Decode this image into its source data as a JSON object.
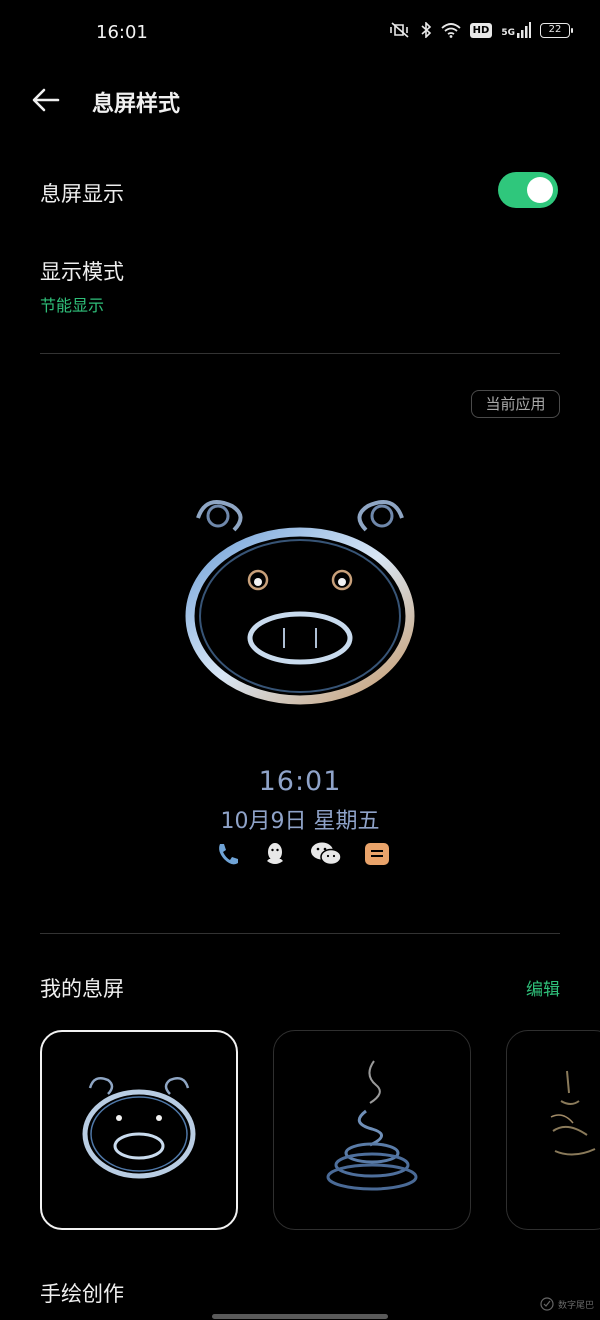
{
  "status_bar": {
    "time": "16:01",
    "network": "5G",
    "hd": "HD",
    "battery": "22",
    "icons": [
      "mute-vibrate-icon",
      "bluetooth-icon",
      "wifi-icon",
      "hd-icon",
      "signal-icon",
      "battery-icon"
    ]
  },
  "header": {
    "title": "息屏样式",
    "back_icon": "arrow-left-icon"
  },
  "settings": {
    "aod_label": "息屏显示",
    "aod_enabled": true,
    "mode_label": "显示模式",
    "mode_value": "节能显示"
  },
  "preview": {
    "badge": "当前应用",
    "time": "16:01",
    "date": "10月9日 星期五",
    "notification_icons": [
      "phone-icon",
      "qq-icon",
      "wechat-icon",
      "message-icon"
    ]
  },
  "my_aod": {
    "title": "我的息屏",
    "edit_label": "编辑",
    "cards": [
      {
        "name": "pig-face-style",
        "selected": true
      },
      {
        "name": "swirl-style",
        "selected": false
      },
      {
        "name": "figure-style",
        "selected": false
      }
    ]
  },
  "hand_drawn": {
    "title": "手绘创作"
  },
  "watermark": {
    "text": "数字尾巴"
  },
  "colors": {
    "background": "#000000",
    "accent_green": "#2fc07a",
    "toggle_on": "#2fc77c",
    "preview_text": "#8fa3c9",
    "divider": "#333333"
  }
}
